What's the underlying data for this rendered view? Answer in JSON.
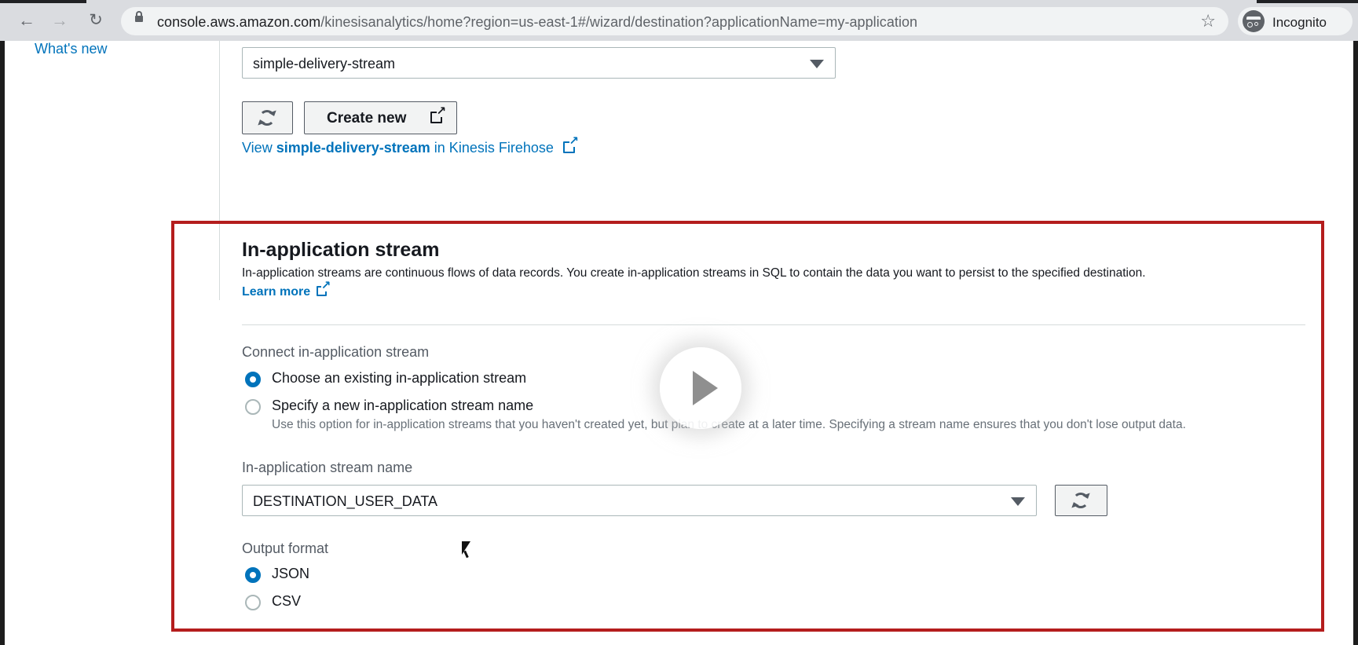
{
  "browser": {
    "url_host": "console.aws.amazon.com",
    "url_path": "/kinesisanalytics/home?region=us-east-1#/wizard/destination?applicationName=my-application",
    "profile_label": "Incognito"
  },
  "sidebar": {
    "whats_new": "What's new"
  },
  "delivery": {
    "selected_stream": "simple-delivery-stream",
    "create_new_label": "Create new",
    "view_prefix": "View ",
    "view_stream": "simple-delivery-stream",
    "view_suffix": " in Kinesis Firehose"
  },
  "in_app_stream": {
    "title": "In-application stream",
    "description": "In-application streams are continuous flows of data records. You create in-application streams in SQL to contain the data you want to persist to the specified destination.",
    "learn_more": "Learn more",
    "connect_label": "Connect in-application stream",
    "options": [
      {
        "label": "Choose an existing in-application stream",
        "selected": true
      },
      {
        "label": "Specify a new in-application stream name",
        "selected": false
      }
    ],
    "new_option_description": "Use this option for in-application streams that you haven't created yet, but plan to create at a later time. Specifying a stream name ensures that you don't lose output data.",
    "stream_name_label": "In-application stream name",
    "stream_name_value": "DESTINATION_USER_DATA",
    "output_format_label": "Output format",
    "formats": [
      {
        "label": "JSON",
        "selected": true
      },
      {
        "label": "CSV",
        "selected": false
      }
    ]
  },
  "colors": {
    "link": "#0073bb",
    "highlight_border": "#b41d1d",
    "radio_selected": "#0073bb"
  },
  "icons": [
    "back-icon",
    "forward-icon",
    "reload-icon",
    "lock-icon",
    "star-icon",
    "incognito-icon",
    "refresh-icon",
    "external-link-icon",
    "caret-down-icon",
    "play-icon",
    "cursor-icon"
  ]
}
